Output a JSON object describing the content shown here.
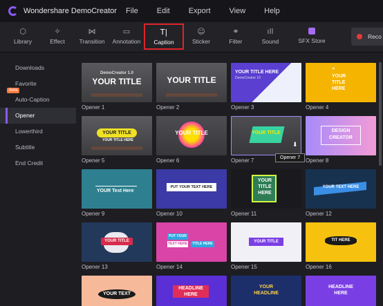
{
  "app": {
    "title": "Wondershare DemoCreator"
  },
  "menu": [
    "File",
    "Edit",
    "Export",
    "View",
    "Help"
  ],
  "toolbar": {
    "tools": [
      {
        "label": "Library",
        "icon": "cube-icon"
      },
      {
        "label": "Effect",
        "icon": "magic-wand-icon"
      },
      {
        "label": "Transition",
        "icon": "bowtie-icon"
      },
      {
        "label": "Annotation",
        "icon": "comment-icon"
      },
      {
        "label": "Caption",
        "icon": "text-cursor-icon"
      },
      {
        "label": "Sticker",
        "icon": "smiley-icon"
      },
      {
        "label": "Filter",
        "icon": "circles-icon"
      },
      {
        "label": "Sound",
        "icon": "waveform-icon"
      },
      {
        "label": "SFX Store",
        "icon": "store-icon"
      }
    ],
    "active": "Caption",
    "record_label": "Reco"
  },
  "sidebar": {
    "items": [
      {
        "label": "Downloads"
      },
      {
        "label": "Favorite"
      },
      {
        "label": "Auto-Caption",
        "badge": "Beta"
      },
      {
        "label": "Opener",
        "active": true
      },
      {
        "label": "Lowerthird"
      },
      {
        "label": "Subtitle"
      },
      {
        "label": "End Credit"
      }
    ]
  },
  "thumb_text": {
    "your_title": "YOUR TITLE",
    "democreator_sm": "DemoCreator 1.0",
    "your_title_here": "YOUR TITLE HERE",
    "democreator_10": "DemoCreator 10",
    "title_here": "TITLE HERE",
    "your_text_here": "YOUR TEXT HERE",
    "your_text_here_mix": "YOUR Text Here",
    "design_creator": "DESIGN CREATOR",
    "put_your_text_here": "PUT YOUR TEXT HERE",
    "your_text_here_long": "YOUR TEXT HERE",
    "put_your": "PUT YOUR",
    "text_here": "TEXT HERE",
    "title_here2": "TITLE HERE",
    "tit_here": "TIT HERE",
    "your_text": "YOUR TEXT",
    "headline_here": "HEADLINE HERE",
    "your_headline": "YOUR HEADLINE",
    "dot_here": "HERE",
    "headline_16": "HEADLINE HERE",
    "your_title_sub": "YOUR TITLE HERE"
  },
  "tooltip": "Opener 7",
  "cards": [
    {
      "label": "Opener 1"
    },
    {
      "label": "Opener 2"
    },
    {
      "label": "Opener 3"
    },
    {
      "label": "Opener 4"
    },
    {
      "label": "Opener 5"
    },
    {
      "label": "Opener 6"
    },
    {
      "label": "Opener 7"
    },
    {
      "label": "Opener 8"
    },
    {
      "label": "Opener 9"
    },
    {
      "label": "Opener 10"
    },
    {
      "label": "Opener 11"
    },
    {
      "label": "Opener 12"
    },
    {
      "label": "Opener 13"
    },
    {
      "label": "Opener 14"
    },
    {
      "label": "Opener 15"
    },
    {
      "label": "Opener 16"
    }
  ],
  "colors": {
    "accent": "#8b5cf6",
    "highlight": "#e0242a"
  }
}
